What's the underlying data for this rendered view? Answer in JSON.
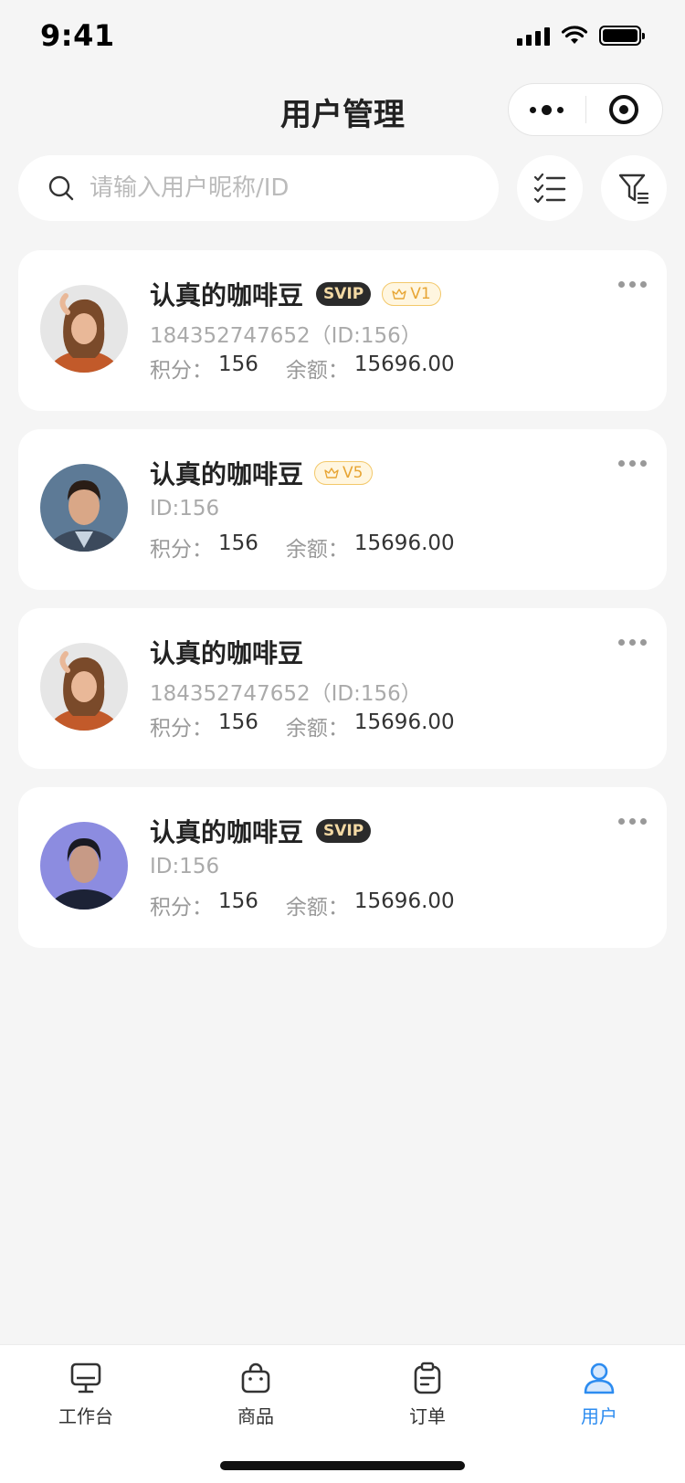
{
  "status_bar": {
    "time": "9:41"
  },
  "nav": {
    "title": "用户管理",
    "more_icon": "more-dots-icon",
    "close_icon": "target-icon"
  },
  "search": {
    "placeholder": "请输入用户昵称/ID",
    "value": ""
  },
  "toolbar": {
    "list_icon": "checklist-icon",
    "filter_icon": "filter-icon"
  },
  "users": [
    {
      "name": "认真的咖啡豆",
      "svip": "SVIP",
      "level": "V1",
      "sub": "184352747652（ID:156）",
      "points_label": "积分：",
      "points": "156",
      "balance_label": "余额：",
      "balance": "15696.00",
      "avatar": "woman-orange"
    },
    {
      "name": "认真的咖啡豆",
      "svip": "",
      "level": "V5",
      "sub": "ID:156",
      "points_label": "积分：",
      "points": "156",
      "balance_label": "余额：",
      "balance": "15696.00",
      "avatar": "man-suit"
    },
    {
      "name": "认真的咖啡豆",
      "svip": "",
      "level": "",
      "sub": "184352747652（ID:156）",
      "points_label": "积分：",
      "points": "156",
      "balance_label": "余额：",
      "balance": "15696.00",
      "avatar": "woman-orange"
    },
    {
      "name": "认真的咖啡豆",
      "svip": "SVIP",
      "level": "",
      "sub": "ID:156",
      "points_label": "积分：",
      "points": "156",
      "balance_label": "余额：",
      "balance": "15696.00",
      "avatar": "woman-blue"
    }
  ],
  "tabs": [
    {
      "label": "工作台",
      "icon": "desktop-icon",
      "active": false
    },
    {
      "label": "商品",
      "icon": "bag-icon",
      "active": false
    },
    {
      "label": "订单",
      "icon": "clipboard-icon",
      "active": false
    },
    {
      "label": "用户",
      "icon": "user-icon",
      "active": true
    }
  ],
  "colors": {
    "accent": "#2d8cf0",
    "svip_bg": "#2b2b2b",
    "svip_text": "#f3d9a4",
    "vip_text": "#e7a534",
    "background": "#f5f5f5"
  }
}
